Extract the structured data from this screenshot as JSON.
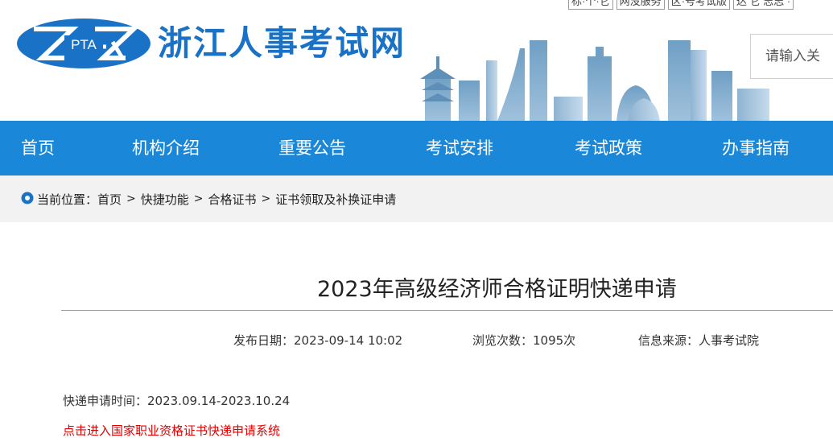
{
  "header": {
    "logo_text": "PTA",
    "site_title": "浙江人事考试网",
    "top_links": [
      "标·个·它",
      "网没服务",
      "区·号考试版",
      "达 它 志志 ·"
    ],
    "search_placeholder": "请输入关"
  },
  "nav": {
    "items": [
      "首页",
      "机构介绍",
      "重要公告",
      "考试安排",
      "考试政策",
      "办事指南"
    ]
  },
  "breadcrumb": {
    "prefix": "当前位置：",
    "items": [
      "首页",
      "快捷功能",
      "合格证书",
      "证书领取及补换证申请"
    ],
    "separator": ">"
  },
  "article": {
    "title": "2023年高级经济师合格证明快递申请",
    "publish_date": "发布日期：2023-09-14 10:02",
    "views": "浏览次数：1095次",
    "source": "信息来源：人事考试院",
    "apply_period": "快递申请时间：2023.09.14-2023.10.24",
    "link_text": "点击进入国家职业资格证书快递申请系统"
  },
  "colors": {
    "brand_blue": "#1a72c7",
    "nav_blue": "#1b87d8",
    "link_red": "#e00000",
    "breadcrumb_bg": "#f2f2f2"
  }
}
